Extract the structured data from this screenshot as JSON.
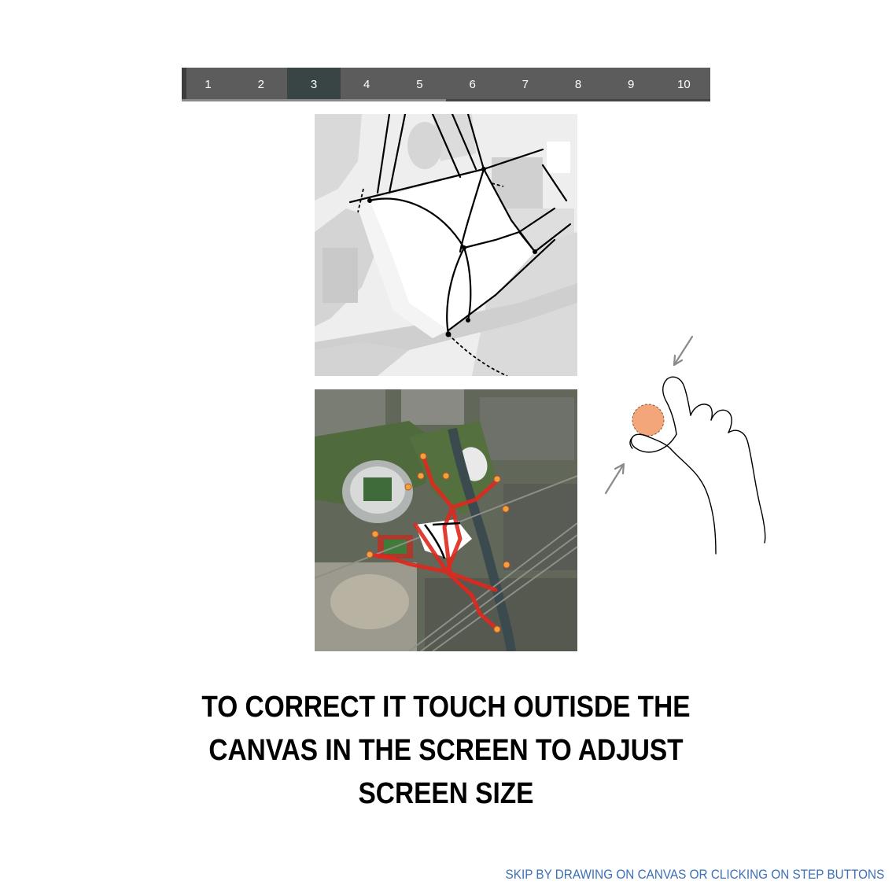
{
  "steps": {
    "items": [
      "1",
      "2",
      "3",
      "4",
      "5",
      "6",
      "7",
      "8",
      "9",
      "10"
    ],
    "active_index": 2,
    "progress_fraction": 0.5
  },
  "instruction": {
    "line1": "TO CORRECT IT TOUCH OUTISDE THE",
    "line2": "CANVAS IN THE SCREEN TO ADJUST",
    "line3": "SCREEN SIZE"
  },
  "footer": {
    "skip_text": "SKIP BY DRAWING ON CANVAS OR CLICKING ON STEP BUTTONS"
  },
  "colors": {
    "stepbar_bg": "#5c5c5c",
    "step_active_bg": "#394444",
    "skip_link": "#3b6fb6",
    "route_red": "#e0281e",
    "node_orange": "#f2a23a",
    "touch_dot": "#f2a679"
  },
  "icons": {
    "gesture": "pinch-zoom-hand-icon"
  }
}
